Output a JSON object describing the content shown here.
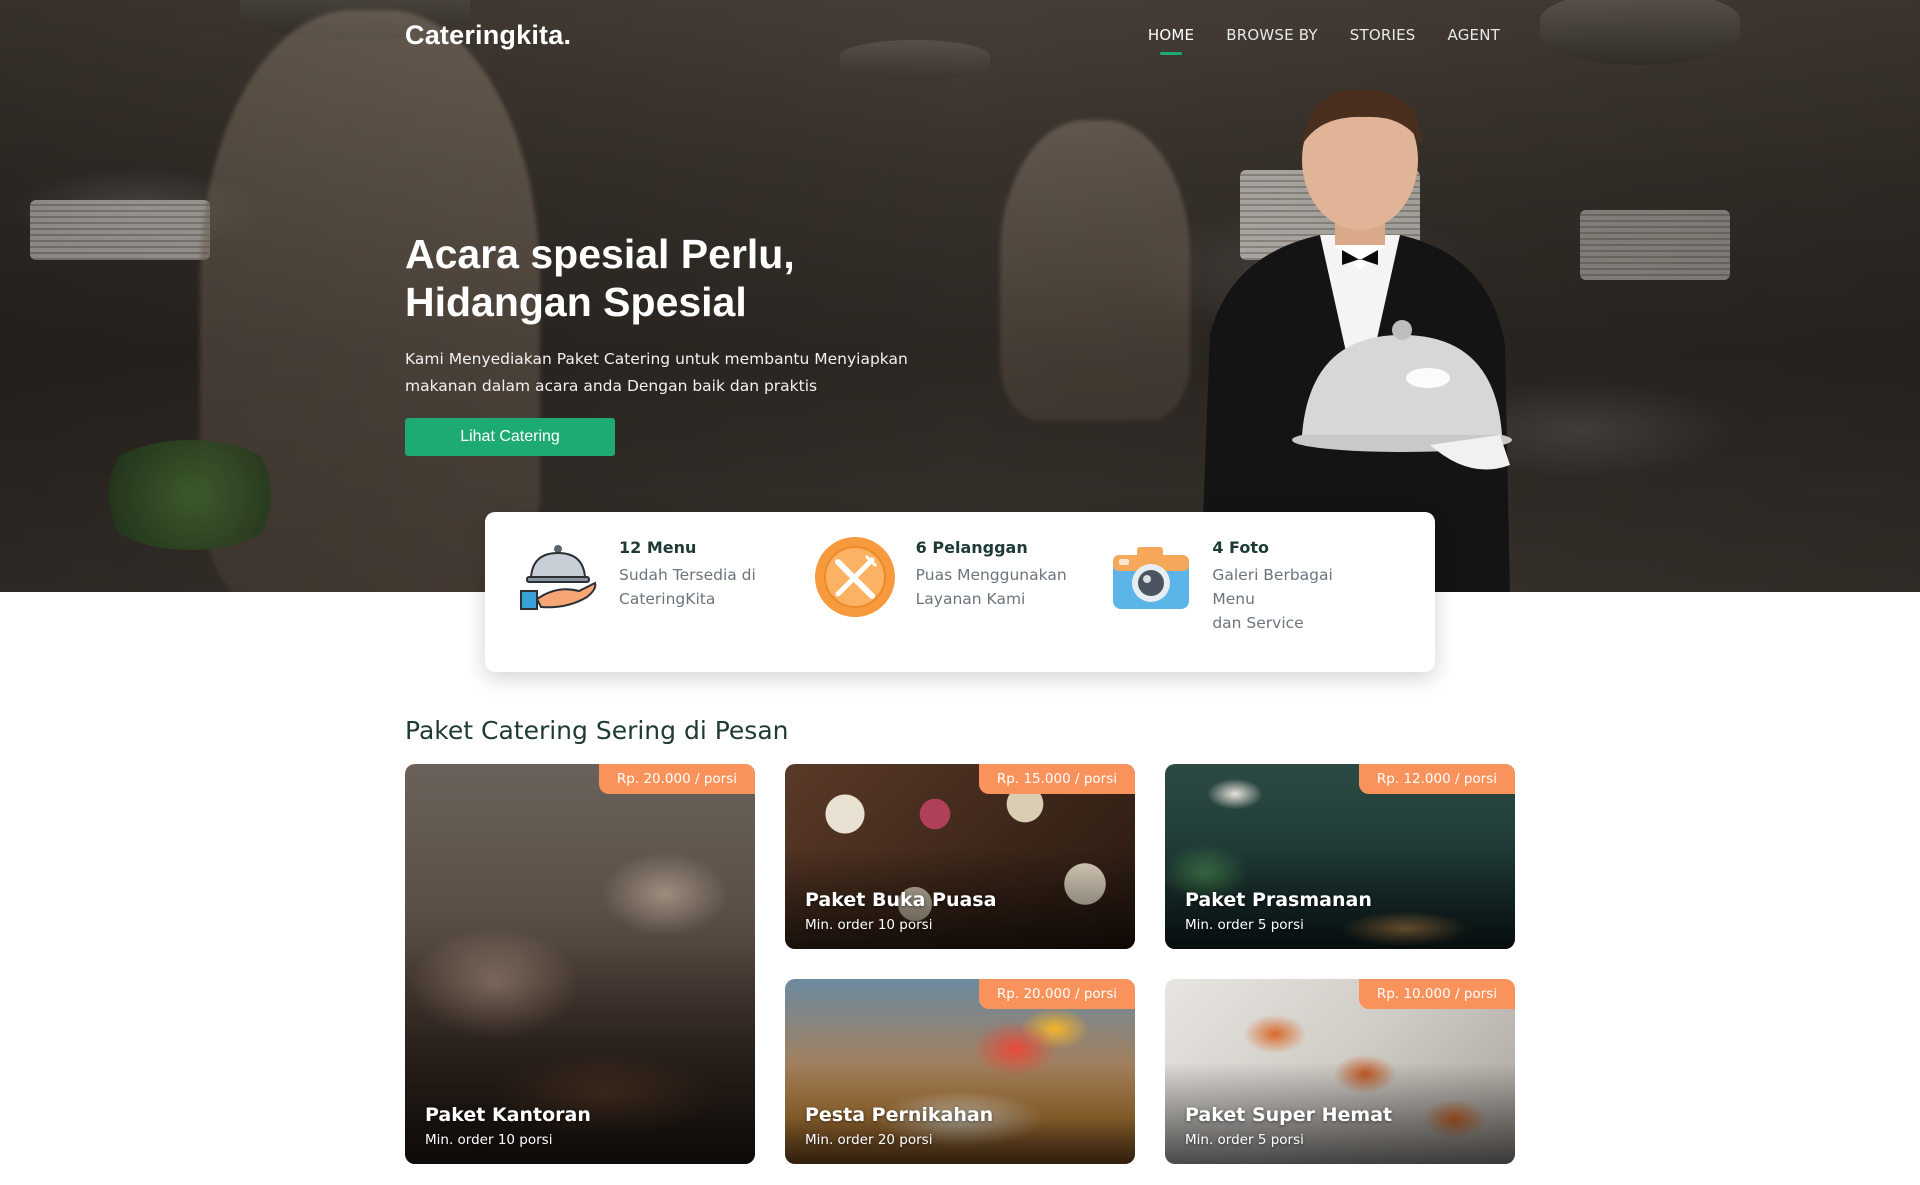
{
  "nav": {
    "logo": "Cateringkita.",
    "items": [
      {
        "label": "HOME",
        "active": true
      },
      {
        "label": "BROWSE BY"
      },
      {
        "label": "STORIES"
      },
      {
        "label": "AGENT"
      }
    ]
  },
  "hero": {
    "title_line1": "Acara spesial Perlu,",
    "title_line2": "Hidangan Spesial",
    "desc_line1": "Kami Menyediakan Paket Catering untuk membantu Menyiapkan",
    "desc_line2": "makanan dalam acara anda Dengan baik dan praktis",
    "cta": "Lihat Catering"
  },
  "stats": [
    {
      "icon": "serving-tray-icon",
      "title": "12 Menu",
      "line1": "Sudah Tersedia di",
      "line2": "CateringKita"
    },
    {
      "icon": "fork-knife-icon",
      "title": "6 Pelanggan",
      "line1": "Puas Menggunakan",
      "line2": "Layanan Kami"
    },
    {
      "icon": "camera-icon",
      "title": "4 Foto",
      "line1": "Galeri Berbagai Menu",
      "line2": "dan Service"
    }
  ],
  "section": {
    "title": "Paket Catering Sering di Pesan"
  },
  "packages": [
    {
      "name": "Paket Kantoran",
      "min": "Min. order 10 porsi",
      "price": "Rp. 20.000 / porsi"
    },
    {
      "name": "Paket Buka Puasa",
      "min": "Min. order 10 porsi",
      "price": "Rp. 15.000 / porsi"
    },
    {
      "name": "Paket Prasmanan",
      "min": "Min. order 5 porsi",
      "price": "Rp. 12.000 / porsi"
    },
    {
      "name": "Pesta Pernikahan",
      "min": "Min. order 20 porsi",
      "price": "Rp. 20.000 / porsi"
    },
    {
      "name": "Paket Super Hemat",
      "min": "Min. order 5 porsi",
      "price": "Rp. 10.000 / porsi"
    }
  ],
  "colors": {
    "accent": "#1dab73",
    "badge": "#f9925b",
    "heading": "#1e3a34"
  }
}
